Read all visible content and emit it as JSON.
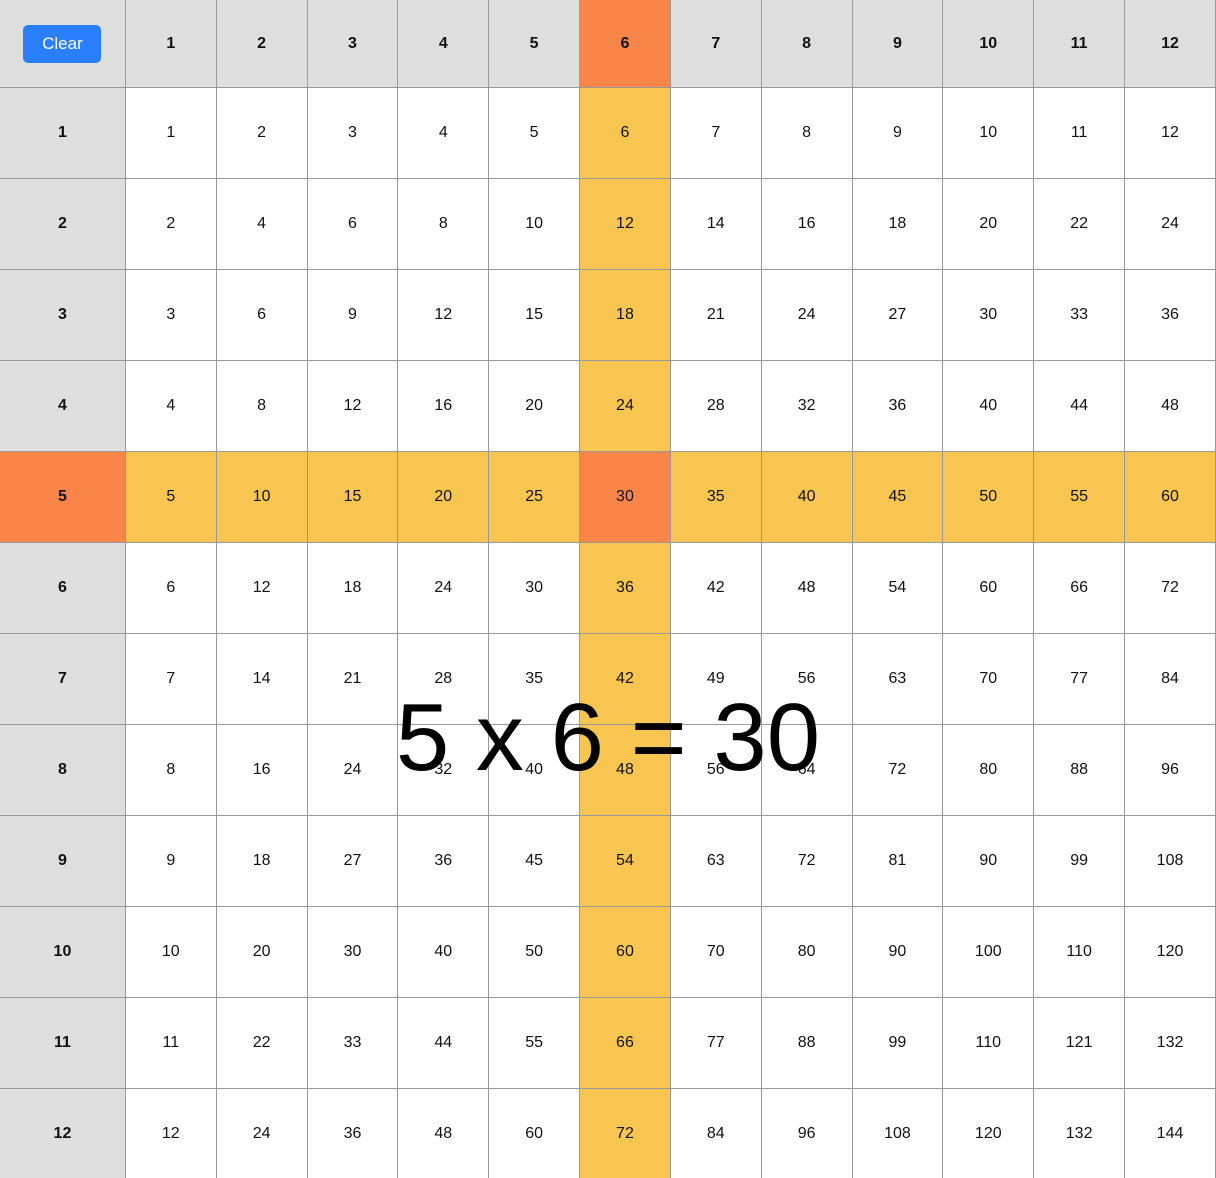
{
  "toolbar": {
    "clear_label": "Clear"
  },
  "colors": {
    "header": "#dedede",
    "highlight": "#f8c550",
    "selected": "#f98549",
    "button": "#2a7fff"
  },
  "selection": {
    "row": 5,
    "column": 6
  },
  "result_text": "5 x 6 = 30",
  "column_headers": [
    "1",
    "2",
    "3",
    "4",
    "5",
    "6",
    "7",
    "8",
    "9",
    "10",
    "11",
    "12"
  ],
  "rows": [
    {
      "header": "1",
      "cells": [
        "1",
        "2",
        "3",
        "4",
        "5",
        "6",
        "7",
        "8",
        "9",
        "10",
        "11",
        "12"
      ]
    },
    {
      "header": "2",
      "cells": [
        "2",
        "4",
        "6",
        "8",
        "10",
        "12",
        "14",
        "16",
        "18",
        "20",
        "22",
        "24"
      ]
    },
    {
      "header": "3",
      "cells": [
        "3",
        "6",
        "9",
        "12",
        "15",
        "18",
        "21",
        "24",
        "27",
        "30",
        "33",
        "36"
      ]
    },
    {
      "header": "4",
      "cells": [
        "4",
        "8",
        "12",
        "16",
        "20",
        "24",
        "28",
        "32",
        "36",
        "40",
        "44",
        "48"
      ]
    },
    {
      "header": "5",
      "cells": [
        "5",
        "10",
        "15",
        "20",
        "25",
        "30",
        "35",
        "40",
        "45",
        "50",
        "55",
        "60"
      ]
    },
    {
      "header": "6",
      "cells": [
        "6",
        "12",
        "18",
        "24",
        "30",
        "36",
        "42",
        "48",
        "54",
        "60",
        "66",
        "72"
      ]
    },
    {
      "header": "7",
      "cells": [
        "7",
        "14",
        "21",
        "28",
        "35",
        "42",
        "49",
        "56",
        "63",
        "70",
        "77",
        "84"
      ]
    },
    {
      "header": "8",
      "cells": [
        "8",
        "16",
        "24",
        "32",
        "40",
        "48",
        "56",
        "64",
        "72",
        "80",
        "88",
        "96"
      ]
    },
    {
      "header": "9",
      "cells": [
        "9",
        "18",
        "27",
        "36",
        "45",
        "54",
        "63",
        "72",
        "81",
        "90",
        "99",
        "108"
      ]
    },
    {
      "header": "10",
      "cells": [
        "10",
        "20",
        "30",
        "40",
        "50",
        "60",
        "70",
        "80",
        "90",
        "100",
        "110",
        "120"
      ]
    },
    {
      "header": "11",
      "cells": [
        "11",
        "22",
        "33",
        "44",
        "55",
        "66",
        "77",
        "88",
        "99",
        "110",
        "121",
        "132"
      ]
    },
    {
      "header": "12",
      "cells": [
        "12",
        "24",
        "36",
        "48",
        "60",
        "72",
        "84",
        "96",
        "108",
        "120",
        "132",
        "144"
      ]
    }
  ]
}
